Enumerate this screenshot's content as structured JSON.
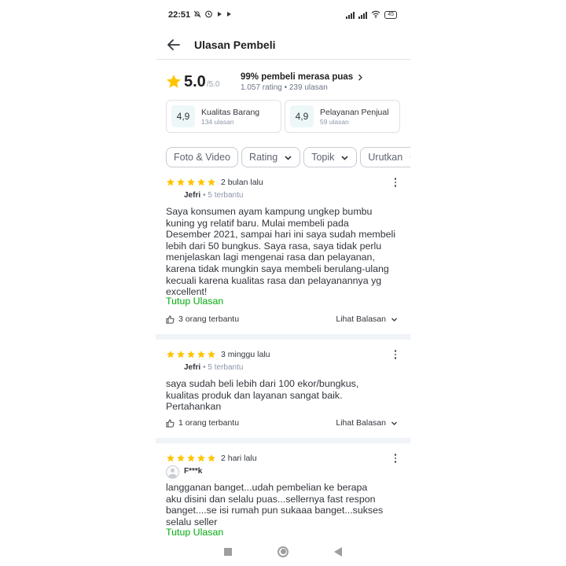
{
  "status_bar": {
    "time": "22:51",
    "battery": "45"
  },
  "header": {
    "title": "Ulasan Pembeli"
  },
  "summary": {
    "score": "5.0",
    "out_of": "/5.0",
    "satisfaction": "99% pembeli merasa puas",
    "counts": "1.057 rating • 239 ulasan"
  },
  "categories": [
    {
      "score": "4,9",
      "label": "Kualitas Barang",
      "count": "134 ulasan"
    },
    {
      "score": "4,9",
      "label": "Pelayanan Penjual",
      "count": "59 ulasan"
    }
  ],
  "filters": [
    {
      "label": "Foto & Video"
    },
    {
      "label": "Rating"
    },
    {
      "label": "Topik"
    },
    {
      "label": "Urutkan"
    }
  ],
  "reviews": [
    {
      "rating": 5,
      "time": "2 bulan lalu",
      "user": "Jefri",
      "badge": "• 5 terbantu",
      "lines": [
        "Saya konsumen ayam kampung ungkep bumbu",
        "kuning yg relatif baru. Mulai membeli pada",
        "Desember 2021, sampai hari ini saya sudah membeli",
        "lebih dari 50 bungkus. Saya rasa, saya tidak perlu",
        "menjelaskan lagi mengenai rasa dan pelayanan,",
        "karena tidak mungkin saya membeli berulang-ulang",
        "kecuali karena kualitas rasa dan pelayanannya yg",
        "excellent!"
      ],
      "toggle": "Tutup Ulasan",
      "helpful": "3 orang terbantu",
      "replies": "Lihat Balasan"
    },
    {
      "rating": 5,
      "time": "3 minggu lalu",
      "user": "Jefri",
      "badge": "• 5 terbantu",
      "lines": [
        "saya sudah beli lebih dari 100 ekor/bungkus,",
        "kualitas produk dan layanan sangat baik.",
        "Pertahankan"
      ],
      "helpful": "1 orang terbantu",
      "replies": "Lihat Balasan"
    },
    {
      "rating": 5,
      "time": "2 hari lalu",
      "user": "F***k",
      "lines": [
        "langganan banget...udah pembelian ke berapa",
        "aku disini dan selalu puas...sellernya fast respon",
        "banget....se isi rumah pun sukaaa banget...sukses",
        "selalu seller"
      ],
      "toggle": "Tutup Ulasan"
    }
  ],
  "colors": {
    "accent": "#03ac0e",
    "star": "#ffc400",
    "divider": "#f0f3f7"
  }
}
